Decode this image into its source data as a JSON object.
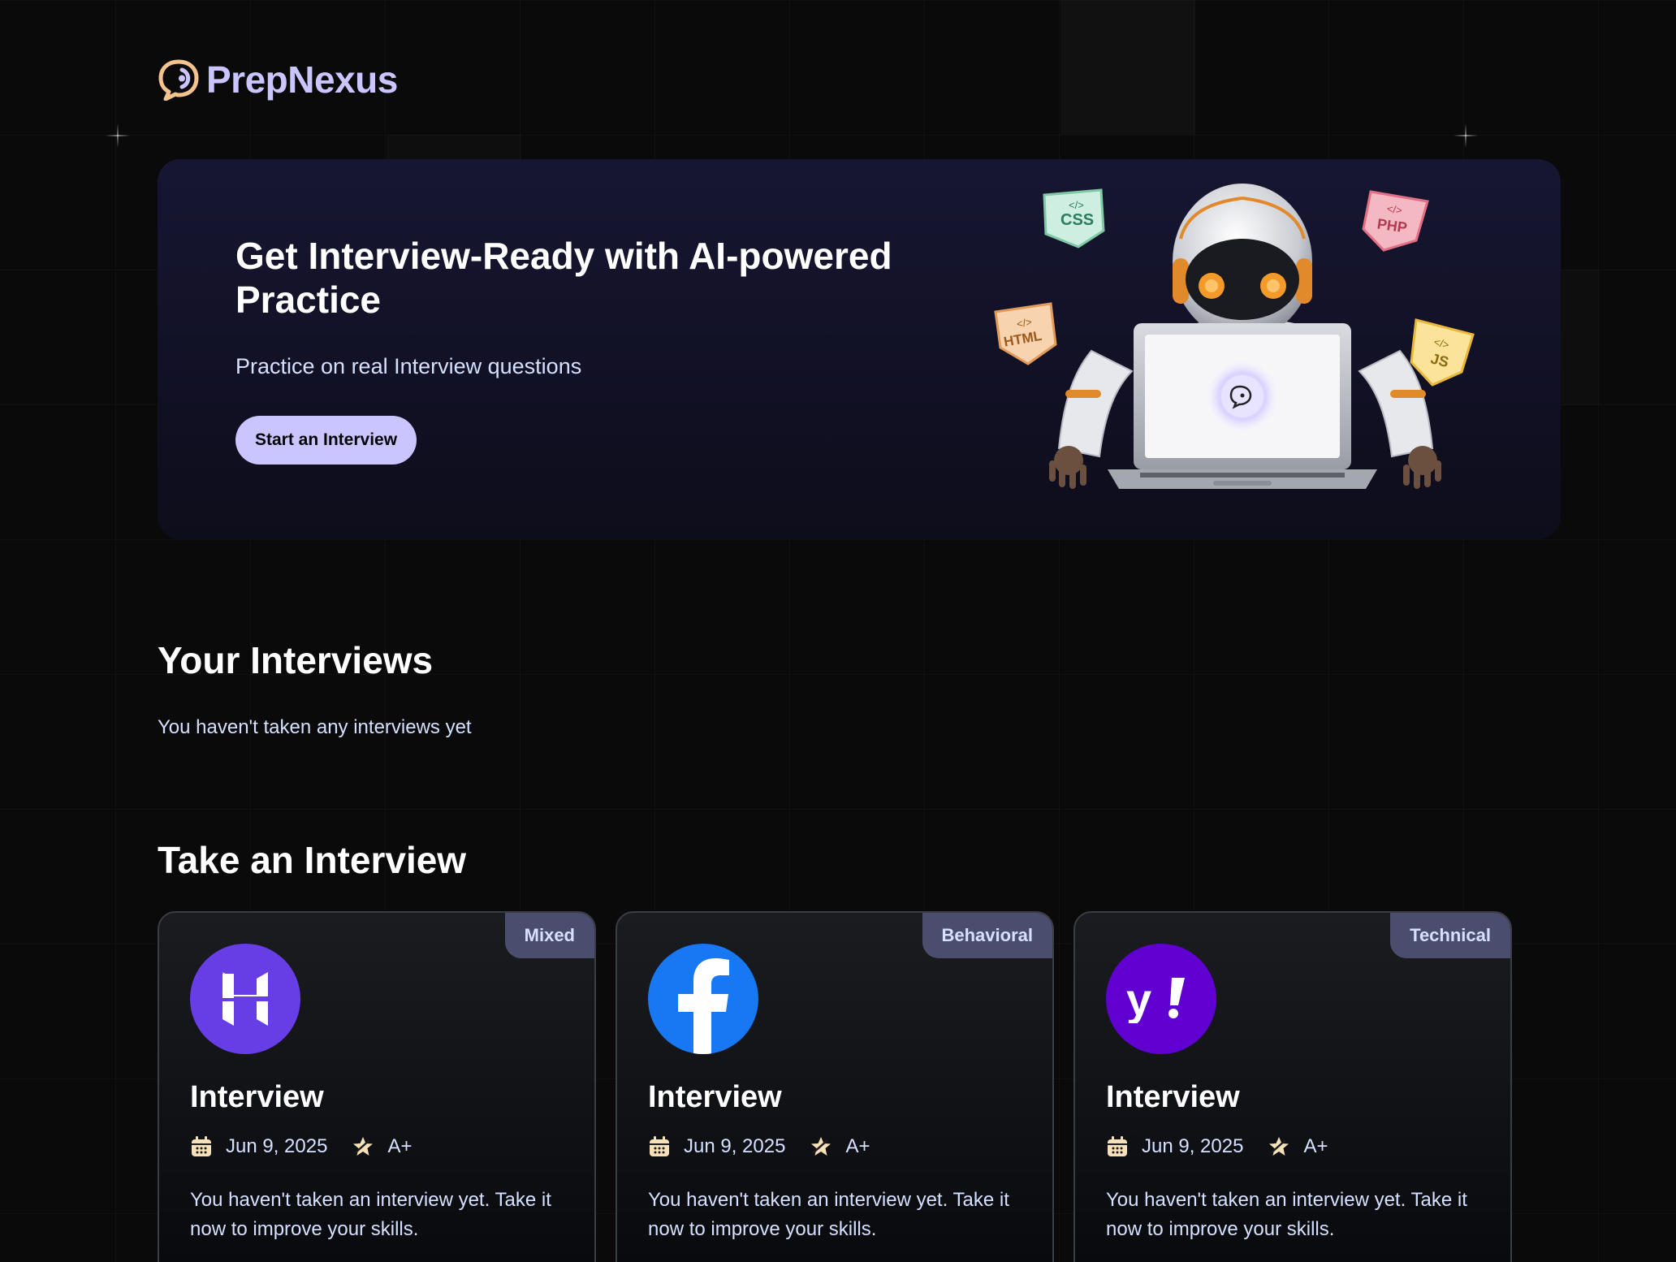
{
  "brand": {
    "name": "PrepNexus",
    "accent": "#cac5fe"
  },
  "hero": {
    "title": "Get Interview-Ready with AI-powered Practice",
    "subtitle": "Practice on real Interview questions",
    "cta_label": "Start an Interview",
    "badges": [
      "CSS",
      "PHP",
      "HTML",
      "JS"
    ]
  },
  "your_interviews": {
    "title": "Your Interviews",
    "empty_text": "You haven't taken any interviews yet"
  },
  "take_interview": {
    "title": "Take an Interview",
    "cards": [
      {
        "badge": "Mixed",
        "logo": "hostinger-logo",
        "logo_color": "#673de6",
        "title": "Interview",
        "date": "Jun 9, 2025",
        "score": "A+",
        "description": "You haven't taken an interview yet. Take it now to improve your skills."
      },
      {
        "badge": "Behavioral",
        "logo": "facebook-logo",
        "logo_color": "#1877f2",
        "title": "Interview",
        "date": "Jun 9, 2025",
        "score": "A+",
        "description": "You haven't taken an interview yet. Take it now to improve your skills."
      },
      {
        "badge": "Technical",
        "logo": "yahoo-logo",
        "logo_color": "#6001d2",
        "title": "Interview",
        "date": "Jun 9, 2025",
        "score": "A+",
        "description": "You haven't taken an interview yet. Take it now to improve your skills."
      }
    ]
  }
}
